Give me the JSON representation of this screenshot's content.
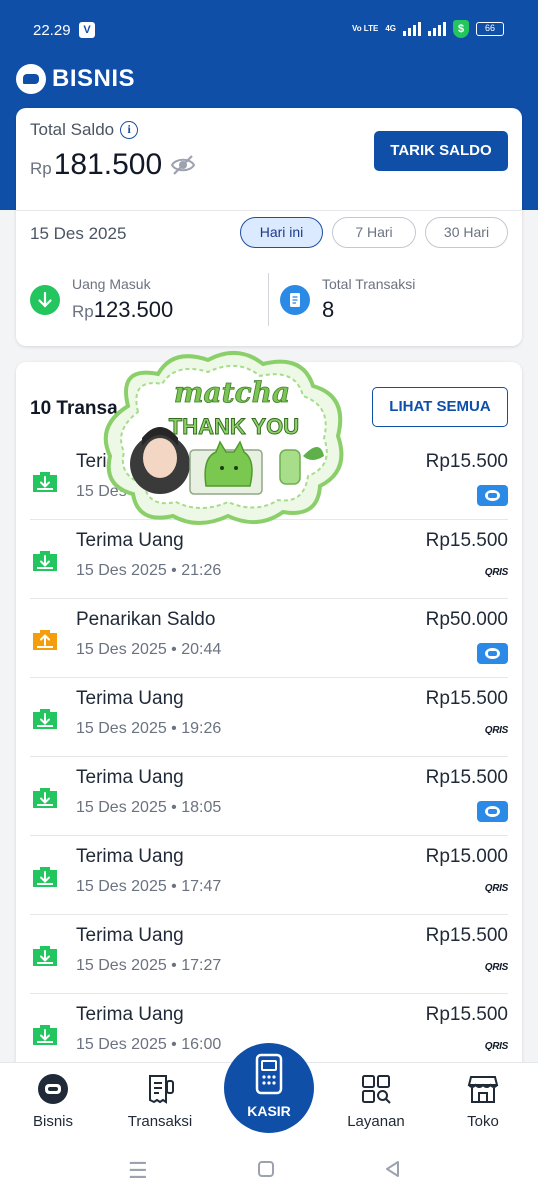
{
  "status_bar": {
    "time": "22.29",
    "app_badge": "V",
    "network_label": "Vo LTE",
    "net_type": "4G",
    "shield_symbol": "$",
    "battery": "66"
  },
  "header": {
    "brand": "BISNIS"
  },
  "balance": {
    "label": "Total Saldo",
    "currency": "Rp",
    "amount": "181.500",
    "withdraw_button": "TARIK SALDO",
    "date": "15 Des 2025",
    "filters": [
      "Hari ini",
      "7 Hari",
      "30 Hari"
    ],
    "active_filter": "Hari ini",
    "incoming": {
      "label": "Uang Masuk",
      "currency": "Rp",
      "value": "123.500"
    },
    "total_tx": {
      "label": "Total Transaksi",
      "value": "8"
    }
  },
  "transactions": {
    "title": "10 Transa",
    "see_all": "LIHAT SEMUA",
    "items": [
      {
        "title": "Terima Uang",
        "subtitle": "15 Des",
        "amount": "Rp15.500",
        "method": "bisnis",
        "type": "in"
      },
      {
        "title": "Terima Uang",
        "subtitle": "15 Des 2025 • 21:26",
        "amount": "Rp15.500",
        "method": "QRIS",
        "type": "in"
      },
      {
        "title": "Penarikan Saldo",
        "subtitle": "15 Des 2025 • 20:44",
        "amount": "Rp50.000",
        "method": "bisnis",
        "type": "out"
      },
      {
        "title": "Terima Uang",
        "subtitle": "15 Des 2025 • 19:26",
        "amount": "Rp15.500",
        "method": "QRIS",
        "type": "in"
      },
      {
        "title": "Terima Uang",
        "subtitle": "15 Des 2025 • 18:05",
        "amount": "Rp15.500",
        "method": "bisnis",
        "type": "in"
      },
      {
        "title": "Terima Uang",
        "subtitle": "15 Des 2025 • 17:47",
        "amount": "Rp15.000",
        "method": "QRIS",
        "type": "in"
      },
      {
        "title": "Terima Uang",
        "subtitle": "15 Des 2025 • 17:27",
        "amount": "Rp15.500",
        "method": "QRIS",
        "type": "in"
      },
      {
        "title": "Terima Uang",
        "subtitle": "15 Des 2025 • 16:00",
        "amount": "Rp15.500",
        "method": "QRIS",
        "type": "in"
      }
    ]
  },
  "sticker": {
    "line1": "matcha",
    "line2": "THANK YOU"
  },
  "bottom_nav": {
    "bisnis": "Bisnis",
    "transaksi": "Transaksi",
    "kasir": "KASIR",
    "layanan": "Layanan",
    "toko": "Toko"
  },
  "colors": {
    "primary": "#0f4fa8",
    "incoming": "#22c55e",
    "outgoing": "#f59e0b",
    "bisnis_badge": "#2b8ae6"
  }
}
